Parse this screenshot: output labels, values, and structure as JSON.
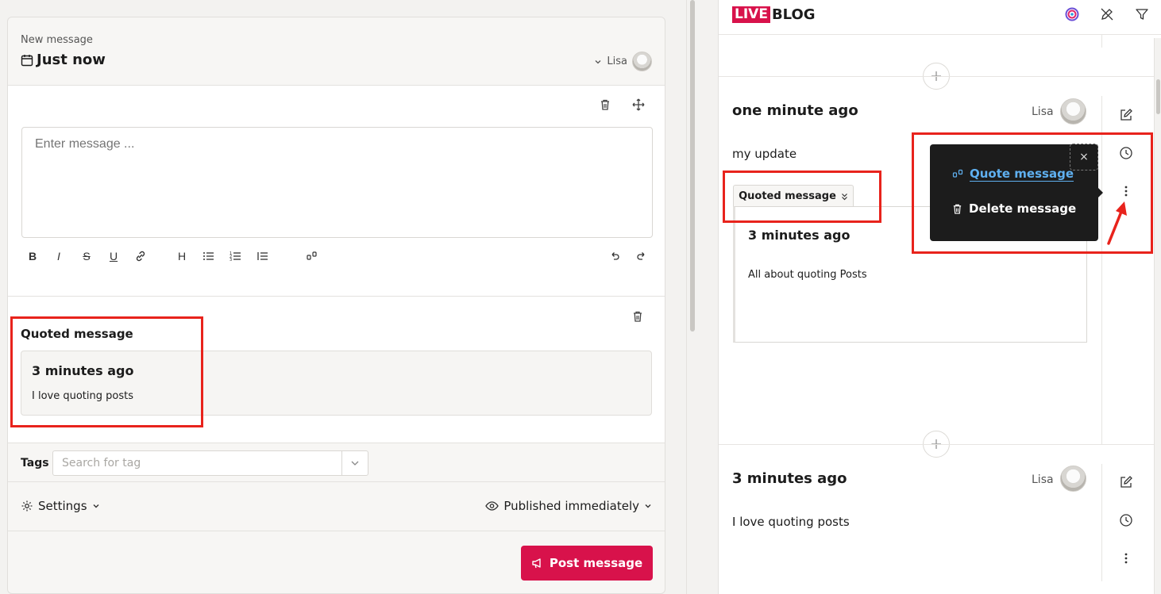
{
  "editor": {
    "subtitle": "New message",
    "title": "Just now",
    "author": "Lisa",
    "message_placeholder": "Enter message ...",
    "toolbar": {
      "bold": "B",
      "italic": "I",
      "strike": "S",
      "underline": "U",
      "heading": "H"
    },
    "quote_block": {
      "title": "Quoted message",
      "card_time": "3 minutes ago",
      "card_text": "I love quoting posts"
    },
    "tags": {
      "label": "Tags",
      "placeholder": "Search for tag"
    },
    "settings_label": "Settings",
    "publish_label": "Published immediately",
    "post_button": "Post message"
  },
  "liveblog": {
    "logo_live": "LIVE",
    "logo_blog": "BLOG",
    "posts": [
      {
        "time": "one minute ago",
        "author": "Lisa",
        "text": "my update",
        "quoted_toggle": "Quoted message",
        "quoted_time": "3 minutes ago",
        "quoted_text": "All about quoting Posts"
      },
      {
        "time": "3 minutes ago",
        "author": "Lisa",
        "text": "I love quoting posts"
      }
    ],
    "context_menu": {
      "close": "×",
      "quote": "Quote message",
      "delete": "Delete message"
    }
  },
  "colors": {
    "accent": "#d8124b",
    "highlight": "#e8231c",
    "link": "#5fb0f0",
    "menu_bg": "#1c1c1c"
  },
  "icons": [
    "calendar-icon",
    "chevron-down-icon",
    "trash-icon",
    "move-icon",
    "link-icon",
    "list-icon",
    "ordered-list-icon",
    "quote-icon",
    "undo-icon",
    "redo-icon",
    "gear-icon",
    "eye-icon",
    "megaphone-icon",
    "plus-icon",
    "edit-icon",
    "clock-icon",
    "more-vertical-icon",
    "filter-icon",
    "pen-off-icon",
    "logo-swirl-icon",
    "arrow-icon"
  ]
}
